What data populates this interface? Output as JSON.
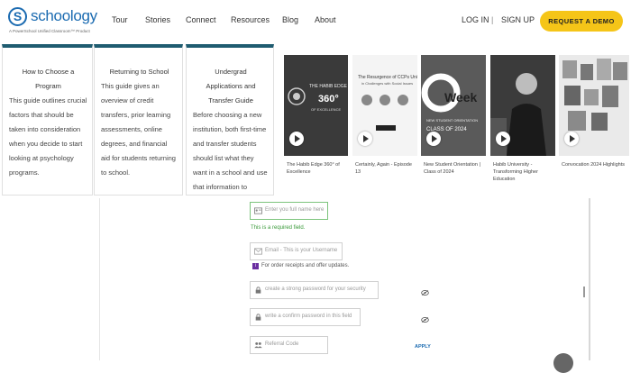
{
  "brand": {
    "name": "schoology",
    "mark": "S",
    "tagline": "A PowerSchool Unified Classroom™ Product"
  },
  "nav": {
    "links": [
      "Tour",
      "Stories",
      "Connect",
      "Resources",
      "Blog",
      "About"
    ],
    "login": "LOG IN",
    "separator": "|",
    "signup": "SIGN UP",
    "demo": "REQUEST A DEMO"
  },
  "cards": [
    {
      "title": "How to Choose a Program",
      "text": "This guide outlines crucial factors that should be taken into consideration when you decide to start looking at psychology programs."
    },
    {
      "title": "Returning to School",
      "text": "This guide gives an overview of credit transfers, prior learning assessments, online degrees, and financial aid for students returning to school."
    },
    {
      "title": "Undergrad Applications and Transfer Guide",
      "text": "Before choosing a new institution, both first-time and transfer students should list what they want in a school and use that information to narrow down their top choices."
    }
  ],
  "videos": [
    {
      "caption": "The Habib Edge 360° of Excellence",
      "thumb_text": "THE HABIB EDGE 360° OF EXCELLENCE"
    },
    {
      "caption": "Certainly, Again - Episode 13",
      "thumb_text": "The Resurgence of CCPs Units in Challenges with Social Issues"
    },
    {
      "caption": "New Student Orientation | Class of 2024",
      "thumb_text": "Week"
    },
    {
      "caption": "Habib University - Transforming Higher Education",
      "thumb_text": ""
    },
    {
      "caption": "Convocation 2024 Highlights",
      "thumb_text": ""
    }
  ],
  "form": {
    "name_placeholder": "Enter you full name here",
    "required_msg": "This is a required field.",
    "email_placeholder": "Email - This is your Username",
    "email_info": "For order receipts and offer updates.",
    "password_placeholder": "create a strong password for your security",
    "confirm_placeholder": "write a confirm password in this field",
    "referral_placeholder": "Referral Code",
    "apply": "APPLY"
  },
  "colors": {
    "brand_blue": "#1b6bb1",
    "demo_yellow": "#f5c518",
    "card_top": "#1f5c70",
    "success_green": "#3a9a3a",
    "info_purple": "#6a2ea0"
  }
}
